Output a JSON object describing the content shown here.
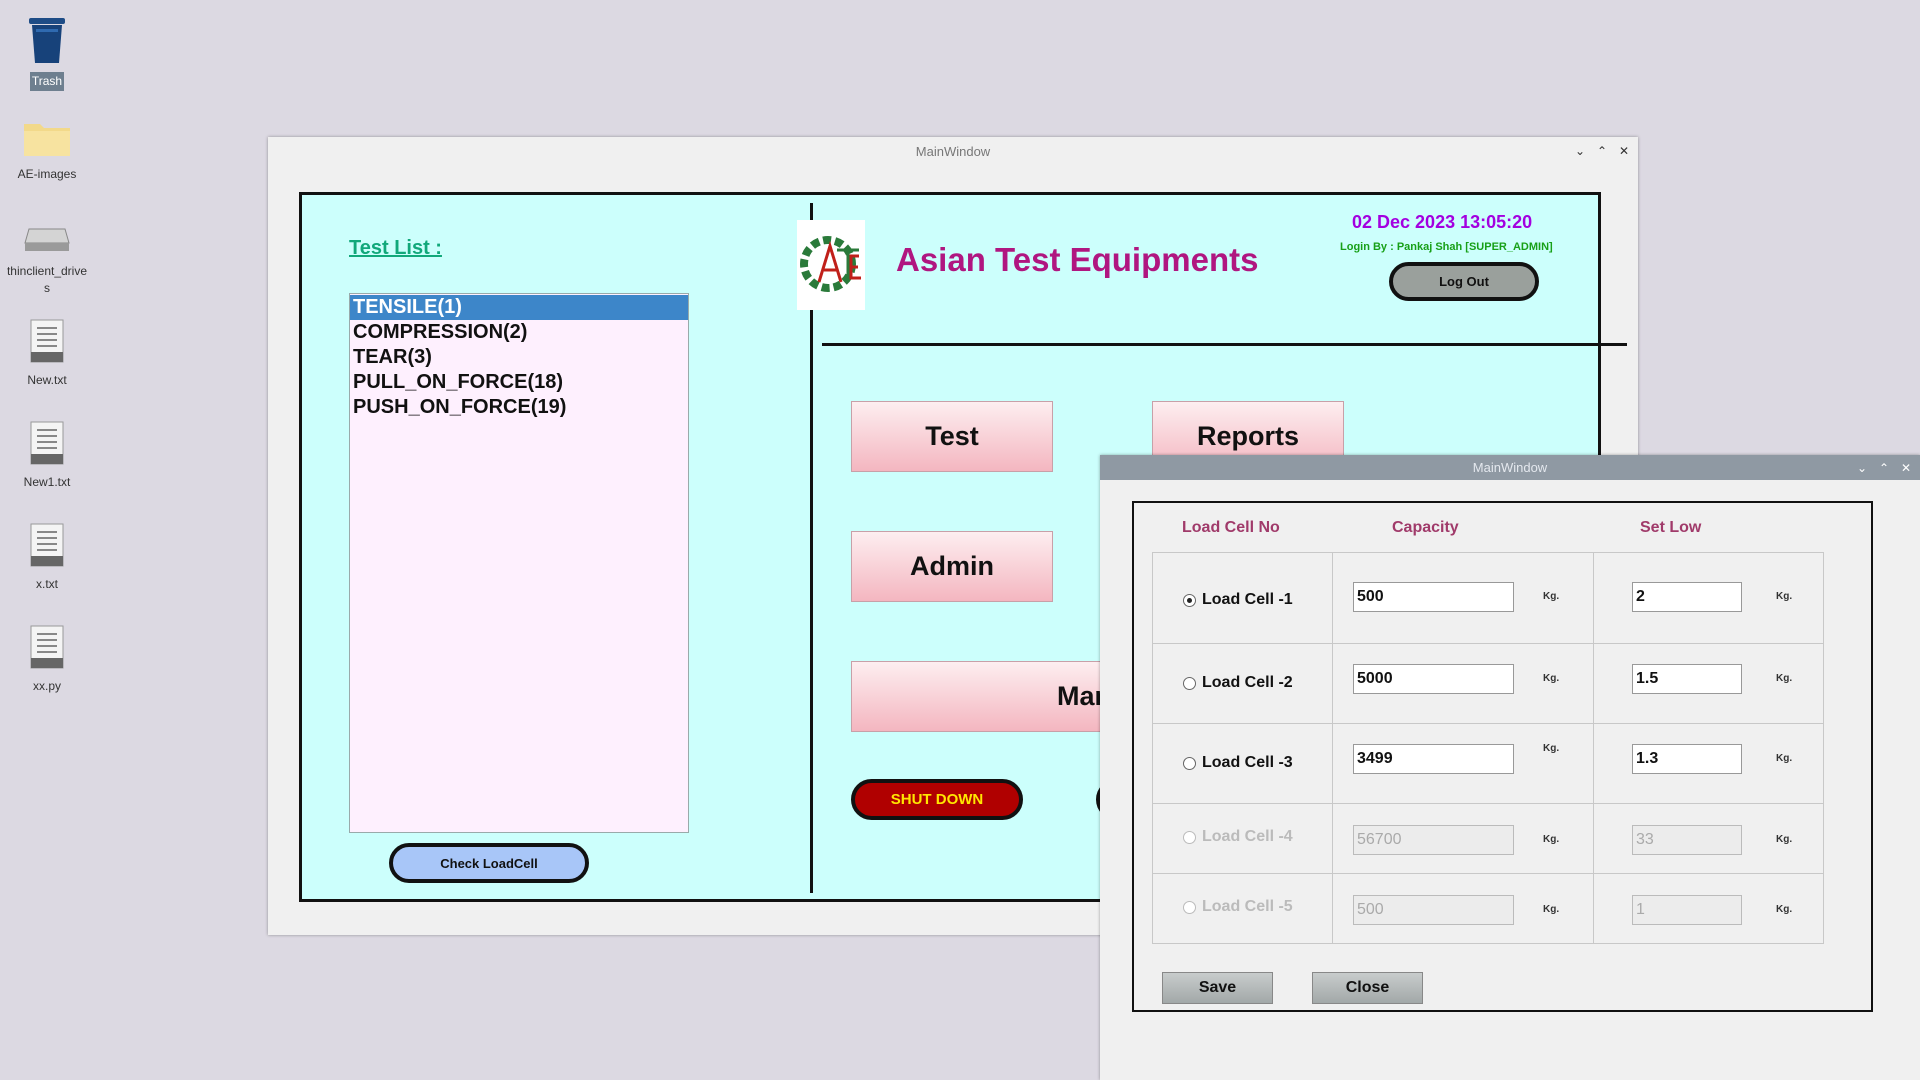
{
  "desktop": {
    "icons": [
      {
        "label": "Trash"
      },
      {
        "label": "AE-images"
      },
      {
        "label": "thinclient_drives"
      },
      {
        "label": "New.txt"
      },
      {
        "label": "New1.txt"
      },
      {
        "label": "x.txt"
      },
      {
        "label": "xx.py"
      }
    ]
  },
  "main_window": {
    "title": "MainWindow",
    "test_list_title": "Test List :",
    "test_list": [
      "TENSILE(1)",
      "COMPRESSION(2)",
      "TEAR(3)",
      "PULL_ON_FORCE(18)",
      "PUSH_ON_FORCE(19)"
    ],
    "selected_test": "TENSILE(1)",
    "check_loadcell_label": "Check LoadCell",
    "company_name": "Asian Test Equipments",
    "datetime": "02 Dec 2023 13:05:20",
    "login_by": "Login By : Pankaj Shah [SUPER_ADMIN]",
    "logout_label": "Log Out",
    "test_label": "Test",
    "reports_label": "Reports",
    "admin_label": "Admin",
    "manual_label": "Manual",
    "shutdown_label": "SHUT DOWN",
    "logo_text": "ATE"
  },
  "dialog": {
    "title": "MainWindow",
    "headers": {
      "load_cell_no": "Load Cell No",
      "capacity": "Capacity",
      "set_low": "Set Low"
    },
    "unit": "Kg.",
    "rows": [
      {
        "label": "Load Cell -1",
        "capacity": "500",
        "set_low": "2",
        "selected": true,
        "enabled": true
      },
      {
        "label": "Load Cell -2",
        "capacity": "5000",
        "set_low": "1.5",
        "selected": false,
        "enabled": true
      },
      {
        "label": "Load Cell -3",
        "capacity": "3499",
        "set_low": "1.3",
        "selected": false,
        "enabled": true
      },
      {
        "label": "Load Cell -4",
        "capacity": "56700",
        "set_low": "33",
        "selected": false,
        "enabled": false
      },
      {
        "label": "Load Cell -5",
        "capacity": "500",
        "set_low": "1",
        "selected": false,
        "enabled": false
      }
    ],
    "save_label": "Save",
    "close_label": "Close"
  },
  "colors": {
    "panel_bg": "#ccfffc",
    "company_name": "#b01680",
    "datetime": "#a300e0",
    "login_by": "#18a018",
    "test_list_title": "#11a87a",
    "shutdown_bg": "#b00000",
    "shutdown_text": "#ffe600"
  }
}
